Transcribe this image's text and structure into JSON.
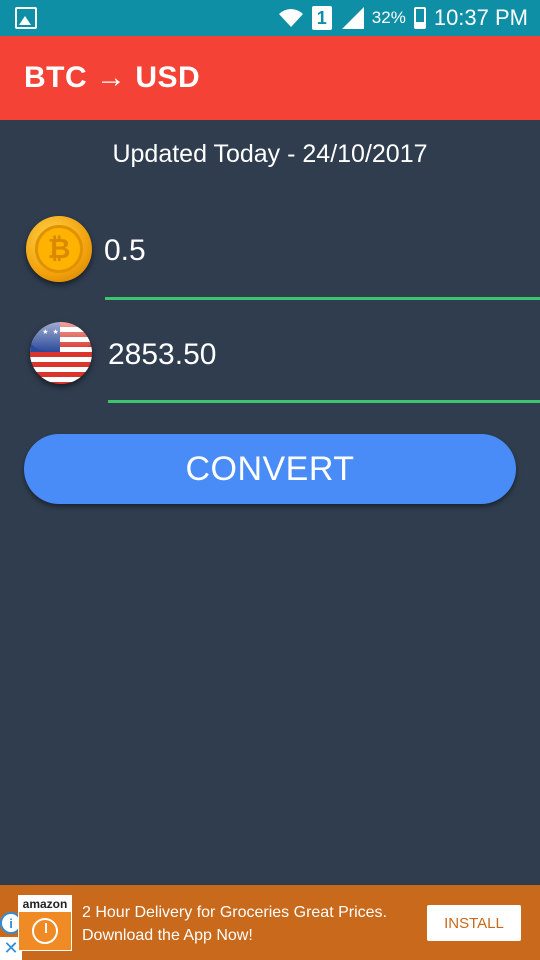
{
  "status_bar": {
    "battery_percent": "32%",
    "time": "10:37 PM",
    "sim_slot": "1",
    "icons": [
      "gallery-icon",
      "wifi-icon",
      "sim-icon",
      "signal-icon",
      "battery-icon"
    ]
  },
  "toolbar": {
    "title": "BTC → USD",
    "color": "#f44336"
  },
  "main": {
    "updated_text": "Updated Today - 24/10/2017",
    "btc_value": "0.5",
    "usd_value": "2853.50",
    "convert_label": "CONVERT",
    "accent_underline": "#3ec46d",
    "button_color": "#4a8cf7",
    "background": "#2f3d4f"
  },
  "ad": {
    "logo_text": "amazon",
    "text": "2 Hour Delivery for Groceries Great Prices. Download the App Now!",
    "install_label": "INSTALL",
    "info_glyph": "i",
    "close_glyph": "✕"
  }
}
